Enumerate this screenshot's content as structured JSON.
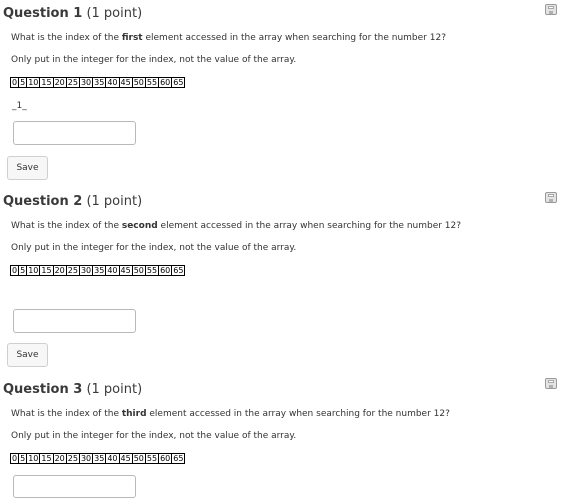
{
  "questions": [
    {
      "title": "Question 1",
      "points": "(1 point)",
      "prompt_before": "What is the index of the ",
      "prompt_bold": "first",
      "prompt_after": " element accessed in the array when searching for the number 12?",
      "instruction": "Only put in the integer for the index, not the value of the array.",
      "array": [
        "0",
        "5",
        "10",
        "15",
        "20",
        "25",
        "30",
        "35",
        "40",
        "45",
        "50",
        "55",
        "60",
        "65"
      ],
      "answer_text": "_1_",
      "input_value": "",
      "save_label": "Save"
    },
    {
      "title": "Question 2",
      "points": "(1 point)",
      "prompt_before": "What is the index of the ",
      "prompt_bold": "second",
      "prompt_after": " element accessed in the array when searching for the number 12?",
      "instruction": "Only put in the integer for the index, not the value of the array.",
      "array": [
        "0",
        "5",
        "10",
        "15",
        "20",
        "25",
        "30",
        "35",
        "40",
        "45",
        "50",
        "55",
        "60",
        "65"
      ],
      "input_value": "",
      "save_label": "Save"
    },
    {
      "title": "Question 3",
      "points": "(1 point)",
      "prompt_before": "What is the index of the ",
      "prompt_bold": "third",
      "prompt_after": " element accessed in the array when searching for the number 12?",
      "instruction": "Only put in the integer for the index, not the value of the array.",
      "array": [
        "0",
        "5",
        "10",
        "15",
        "20",
        "25",
        "30",
        "35",
        "40",
        "45",
        "50",
        "55",
        "60",
        "65"
      ],
      "input_value": ""
    }
  ],
  "colors": {
    "text": "#333333",
    "heading": "#3a3a3a",
    "input_border": "#b9b9b9",
    "button_bg": "#f7f7f7"
  },
  "icons": {
    "save": "floppy-disk-icon"
  }
}
